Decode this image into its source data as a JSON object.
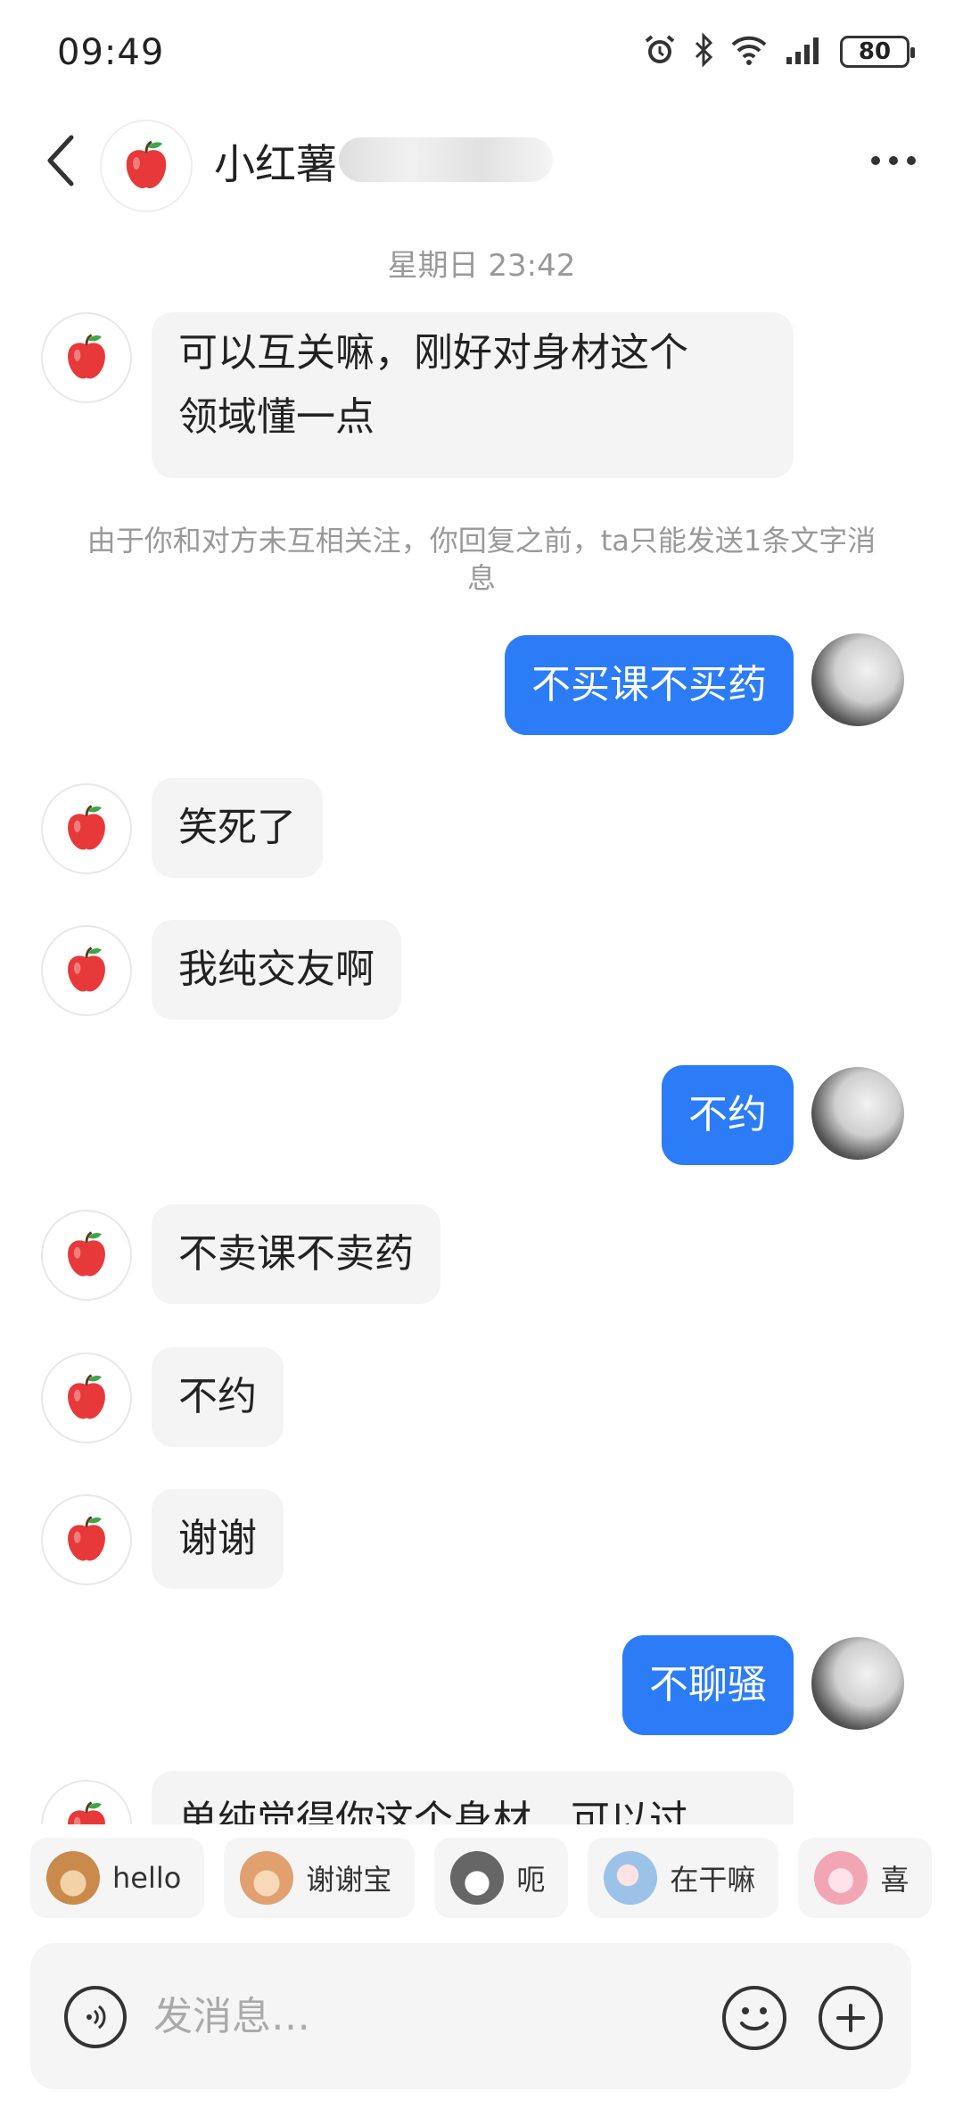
{
  "status_bar": {
    "time": "09:49",
    "battery": "80",
    "icons": [
      "alarm-icon",
      "bluetooth-icon",
      "wifi-icon",
      "signal-icon",
      "battery-icon"
    ]
  },
  "header": {
    "contact_name": "小红薯",
    "back_icon": "chevron-left-icon",
    "more_icon": "more-dots-icon"
  },
  "chat": {
    "timestamp": "星期日 23:42",
    "notice": "由于你和对方未互相关注，你回复之前，ta只能发送1条文字消息",
    "messages": [
      {
        "from": "them",
        "text_lines": [
          "可以互关嘛，刚好对身材这个",
          "领域懂一点"
        ]
      },
      {
        "from": "me",
        "text": "不买课不买药"
      },
      {
        "from": "them",
        "text": "笑死了"
      },
      {
        "from": "them",
        "text": "我纯交友啊"
      },
      {
        "from": "me",
        "text": "不约"
      },
      {
        "from": "them",
        "text": "不卖课不卖药"
      },
      {
        "from": "them",
        "text": "不约"
      },
      {
        "from": "them",
        "text": "谢谢"
      },
      {
        "from": "me",
        "text": "不聊骚"
      },
      {
        "from": "them",
        "text": "单纯觉得你这个身材，可以过"
      }
    ]
  },
  "quick_replies": [
    {
      "label": "hello",
      "emoji": "monkey-emoji",
      "color": "#c98a4b"
    },
    {
      "label": "谢谢宝",
      "emoji": "flower-monkey-emoji",
      "color": "#e0a070"
    },
    {
      "label": "呃",
      "emoji": "cat-emoji",
      "color": "#666666"
    },
    {
      "label": "在干嘛",
      "emoji": "magnifier-emoji",
      "color": "#9bc3e8"
    },
    {
      "label": "喜",
      "emoji": "pig-emoji",
      "color": "#f2a6b4"
    }
  ],
  "input": {
    "placeholder": "发消息…"
  },
  "colors": {
    "outgoing_bubble": "#2b7cf6",
    "incoming_bubble": "#f4f4f4",
    "apple_red": "#e8393a"
  }
}
